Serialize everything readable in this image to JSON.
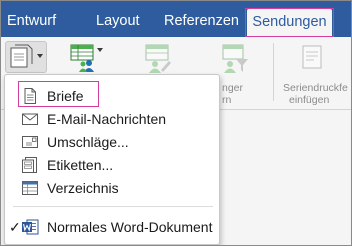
{
  "tabs": [
    {
      "label": "Entwurf",
      "active": false
    },
    {
      "label": "Layout",
      "active": false
    },
    {
      "label": "Referenzen",
      "active": false
    },
    {
      "label": "Sendungen",
      "active": true
    }
  ],
  "ribbon": {
    "label_partial_1": "nger",
    "label_partial_2": "rn",
    "label_seriendruck_1": "Seriendruckfe",
    "label_seriendruck_2": "einfügen"
  },
  "menu": {
    "items": [
      {
        "label": "Briefe",
        "icon": "document-icon"
      },
      {
        "label": "E-Mail-Nachrichten",
        "icon": "envelope-icon"
      },
      {
        "label": "Umschläge...",
        "icon": "envelope-stamp-icon"
      },
      {
        "label": "Etiketten...",
        "icon": "labels-icon"
      },
      {
        "label": "Verzeichnis",
        "icon": "table-icon"
      }
    ],
    "checked_item": {
      "label": "Normales Word-Dokument",
      "icon": "word-icon",
      "checked": true,
      "check_glyph": "✓"
    }
  },
  "colors": {
    "tab_bar": "#2e5c9e",
    "highlight": "#d33d9b",
    "word_blue": "#2b579a"
  }
}
